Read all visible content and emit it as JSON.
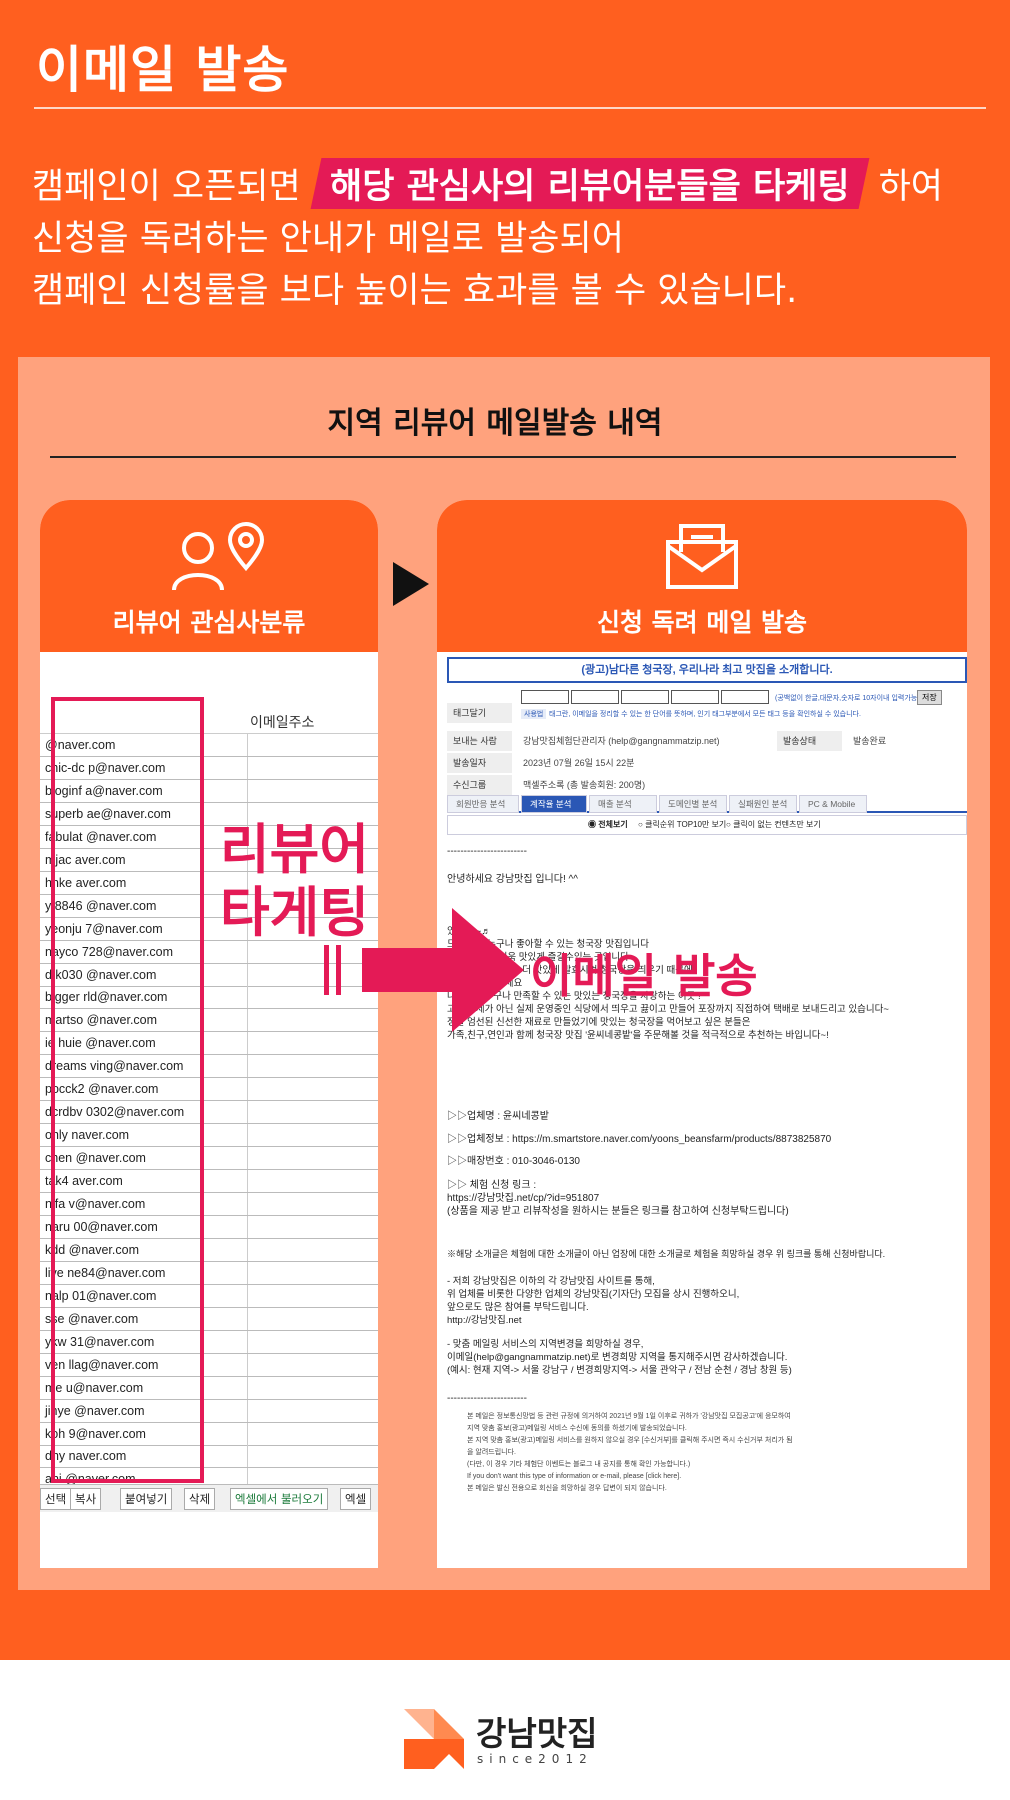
{
  "header": {
    "title": "이메일 발송",
    "intro_before": "캠페인이 오픈되면",
    "intro_highlight": "해당 관심사의 리뷰어분들을 타케팅",
    "intro_after": "하여",
    "intro_line2": "신청을 독려하는 안내가 메일로 발송되어",
    "intro_line3": "캠페인 신청률을 보다 높이는 효과를 볼 수 있습니다."
  },
  "panel": {
    "title": "지역 리뷰어 메일발송 내역",
    "left_card_label": "리뷰어 관심사분류",
    "right_card_label": "신청 독려 메일 발송"
  },
  "left_table": {
    "column_header": "이메일주소",
    "rows": [
      "@naver.com",
      "chic-dc p@naver.com",
      "bloginf a@naver.com",
      "superb ae@naver.com",
      "fabulat @naver.com",
      "mjac aver.com",
      "hnke aver.com",
      "y 8846 @naver.com",
      "yeonju 7@naver.com",
      "nayco 728@naver.com",
      "d k030 @naver.com",
      "bigger rld@naver.com",
      "martso @naver.com",
      "ie huie @naver.com",
      "dreams ving@naver.com",
      "pocck2 @naver.com",
      "dcrdbv 0302@naver.com",
      "ohly naver.com",
      "chen @naver.com",
      "tak4 aver.com",
      "nifa v@naver.com",
      "naru 00@naver.com",
      "kdd @naver.com",
      "live ne84@naver.com",
      "nalp 01@naver.com",
      "sse @naver.com",
      "ykw 31@naver.com",
      "ven llag@naver.com",
      "me u@naver.com",
      "jinye @naver.com",
      "koh 9@naver.com",
      "dhy naver.com",
      "ani @naver.com"
    ],
    "buttons": [
      "선택",
      "복사",
      "붙여넣기",
      "삭제",
      "엑셀에서 불러오기",
      "엑셀"
    ],
    "overlay_line1": "리뷰어",
    "overlay_line2": "타게팅"
  },
  "arrow_label": "이메일 발송",
  "email": {
    "banner": "(광고)남다른 청국장, 우리나라 최고 맛집을 소개합니다.",
    "labels": {
      "tag": "태그달기",
      "sender": "보내는 사람",
      "sent_date": "발송일자",
      "recipients": "수신그룹",
      "status": "발송상태"
    },
    "tag_hint": "(공백없이 한글,대문자,숫자로 10자이내 입력가능)",
    "tag_save": "저장",
    "tag_note": "태그란, 이메일을 정리할 수 있는 한 단어를 뜻하며, 인기 태그부분에서 모든 태그 등을 확인하실 수 있습니다.",
    "tag_badge": "사용법",
    "sender": "강남맛집체험단관리자 (help@gangnammatzip.net)",
    "sent_date": "2023년 07월 26일 15시 22분",
    "recipients": "맥셀주소록 (총 발송회원: 200명)",
    "status": "발송완료",
    "tabs": [
      "회원반응 분석",
      "계작율 분석",
      "매출 분석",
      "도메인별 분석",
      "실패원인 분석",
      "PC & Mobile"
    ],
    "radios": [
      "전체보기",
      "클릭순위 TOP10만 보기",
      "클릭이 없는 컨텐츠만 보기"
    ],
    "dashes": "------------------------",
    "greeting": "안녕하세요 강남맛집 입니다! ^^",
    "body_lines": [
      "있으요 ~♬",
      "드릴 곳은 누구나 좋아할 수 있는 청국장 맛집입니다",
      "게,  청국장을 더욱 맛있게 즐길수있는 곳입니다",
      "같은 청국장이라도 더 맛있게 발효시켜 청국장을 띄우기 때문에",
      "에 정말 드셔보세요",
      "나이불문 누구나 만족할 수 있는 맛있는 청국장을 자랑하는 이곳 !",
      "고 공장제가 아닌 실제 운영중인 식당에서 띄우고 끓이고 만들어 포장까지 직접하여 택배로 보내드리고 있습니다~",
      "정말 엄선된 신선한 재료로 만들었기에 맛있는 청국장을 먹어보고 싶은 분들은",
      "가족,친구,연인과 함께 청국장 맛집 '윤씨네콩밭'을 주문해볼 것을 적극적으로 추천하는 바입니다~!"
    ],
    "biz_name": "▷▷업체명 : 윤씨네콩밭",
    "biz_info": "▷▷업체정보 : https://m.smartstore.naver.com/yoons_beansfarm/products/8873825870",
    "biz_phone": "▷▷매장번호 : 010-3046-0130",
    "apply_title": "▷▷ 체험 신청 링크 :",
    "apply_link": "https://강남맛집.net/cp/?id=951807",
    "apply_note": "(상품을 제공 받고 리뷰작성을 원하시는 분들은 링크를 참고하여 신청부탁드립니다)",
    "notice": "※해당 소개글은 체험에 대한 소개글이 아닌 업장에 대한 소개글로 체험을 희망하실 경우 위 링크를 통해 신청바랍니다.",
    "recruit_lines": [
      "- 저희 강남맛집은 이하의 각 강남맛집 사이트를 통해,",
      "위 업체를 비롯한 다양한 업체의 강남맛집(기자단) 모집을 상시 진행하오니,",
      "앞으로도 많은 참여를 부탁드립니다.",
      "http://강남맛집.net"
    ],
    "region_lines": [
      "- 맞춤 메일링 서비스의 지역변경을 희망하실 경우,",
      "이메일(help@gangnammatzip.net)로 변경희망 지역을 통지해주시면 감사하겠습니다.",
      "(예시:  현재 지역-> 서울 강남구 / 변경희망지역-> 서울 관악구 / 전남 순천 / 경남 창원 등)"
    ],
    "footer_lines": [
      "본 메일은 정보통신망법 등 관련 규정에 의거하여 2021년 9월 1일 이후로 귀하가 '강남맛집 모집공고'에 응모하여",
      "지역 맞춤 홍보(광고)메일링 서비스 수신에 동의를 하셨기에 발송되었습니다.",
      "본 지역 맞춤 홍보(광고)메일링 서비스를 원하지 않으실 경우 [수신거부]를 클릭해 주시면 즉시 수신거부 처리가 됨",
      "을 알려드립니다.",
      "(다만, 이 경우 기타 체험단 이벤트는 블로그 내 공지를 통해 확인 가능합니다.)",
      "If you don't want this type of information or e-mail, please [click here].",
      "본 메일은 발신 전용으로 회신을 희망하실 경우 답변이 되지 않습니다."
    ]
  },
  "footer": {
    "brand": "강남맛집",
    "since": "since2012"
  },
  "colors": {
    "orange": "#ff5f1f",
    "panel": "#ffa27d",
    "pink": "#e41a56",
    "link_blue": "#2a57b5"
  }
}
